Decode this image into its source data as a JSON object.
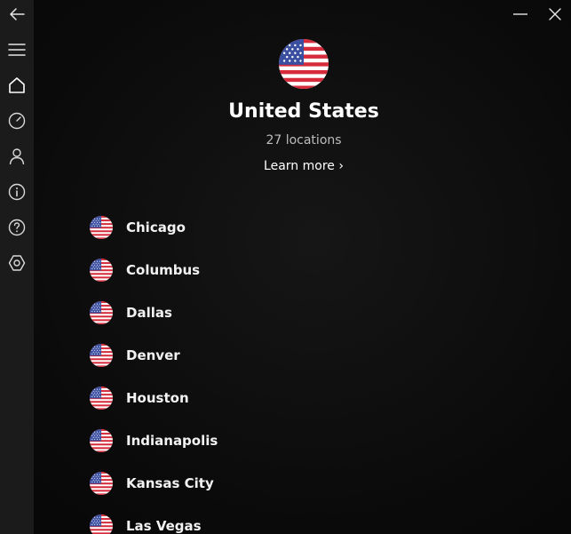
{
  "icons": {
    "back": "arrow-left-icon",
    "menu": "hamburger-menu-icon",
    "home": "home-icon",
    "speed": "speedometer-icon",
    "account": "user-icon",
    "info": "info-icon",
    "help": "question-icon",
    "settings": "settings-hexagon-icon",
    "minimize": "minimize-icon",
    "close": "close-icon",
    "flag": "us-flag-icon"
  },
  "colors": {
    "sidebar_bg": "#1b1b1b",
    "main_bg": "#0d0d0d",
    "text_primary": "#ffffff",
    "text_secondary": "#bdbdbd",
    "flag_red": "#d52b3b",
    "flag_blue": "#3a4fa0"
  },
  "header": {
    "country": "United States",
    "locations_count": "27 locations",
    "learn_more": "Learn more ›"
  },
  "locations": [
    {
      "name": "Chicago"
    },
    {
      "name": "Columbus"
    },
    {
      "name": "Dallas"
    },
    {
      "name": "Denver"
    },
    {
      "name": "Houston"
    },
    {
      "name": "Indianapolis"
    },
    {
      "name": "Kansas City"
    },
    {
      "name": "Las Vegas"
    }
  ]
}
